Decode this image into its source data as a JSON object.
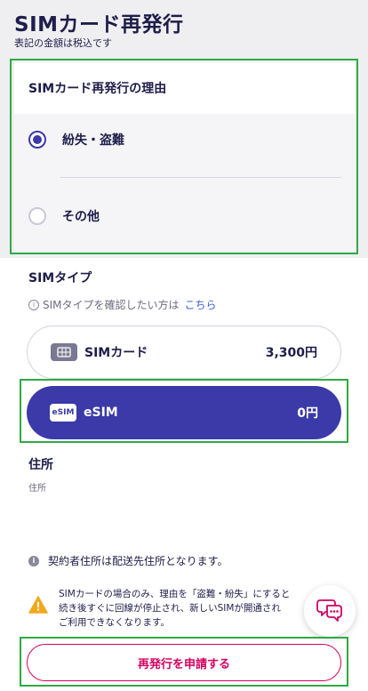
{
  "header": {
    "title": "SIMカード再発行",
    "subtitle": "表記の金額は税込です"
  },
  "reason": {
    "title": "SIMカード再発行の理由",
    "options": [
      {
        "label": "紛失・盗難",
        "selected": true
      },
      {
        "label": "その他",
        "selected": false
      }
    ]
  },
  "sim_type": {
    "title": "SIMタイプ",
    "note": "SIMタイプを確認したい方は",
    "note_link": "こちら",
    "options": [
      {
        "name": "SIMカード",
        "price": "3,300円",
        "selected": false,
        "icon": "sim-card-icon"
      },
      {
        "name": "eSIM",
        "price": "0円",
        "selected": true,
        "icon": "esim-icon",
        "icon_text": "eSIM"
      }
    ]
  },
  "address": {
    "title": "住所",
    "value": "住所"
  },
  "info": {
    "text": "契約者住所は配送先住所となります。"
  },
  "warning": {
    "line1": "SIMカードの場合のみ、理由を「盗難・紛失」にすると",
    "line2": "続き後すぐに回線が停止され、新しいSIMが開通され",
    "line3": "ご利用できなくなります。"
  },
  "submit": {
    "label": "再発行を申請する"
  },
  "colors": {
    "accent": "#3b3aa8",
    "submit": "#d4005f",
    "highlight": "#2eaa45",
    "warning": "#f2a81d"
  }
}
